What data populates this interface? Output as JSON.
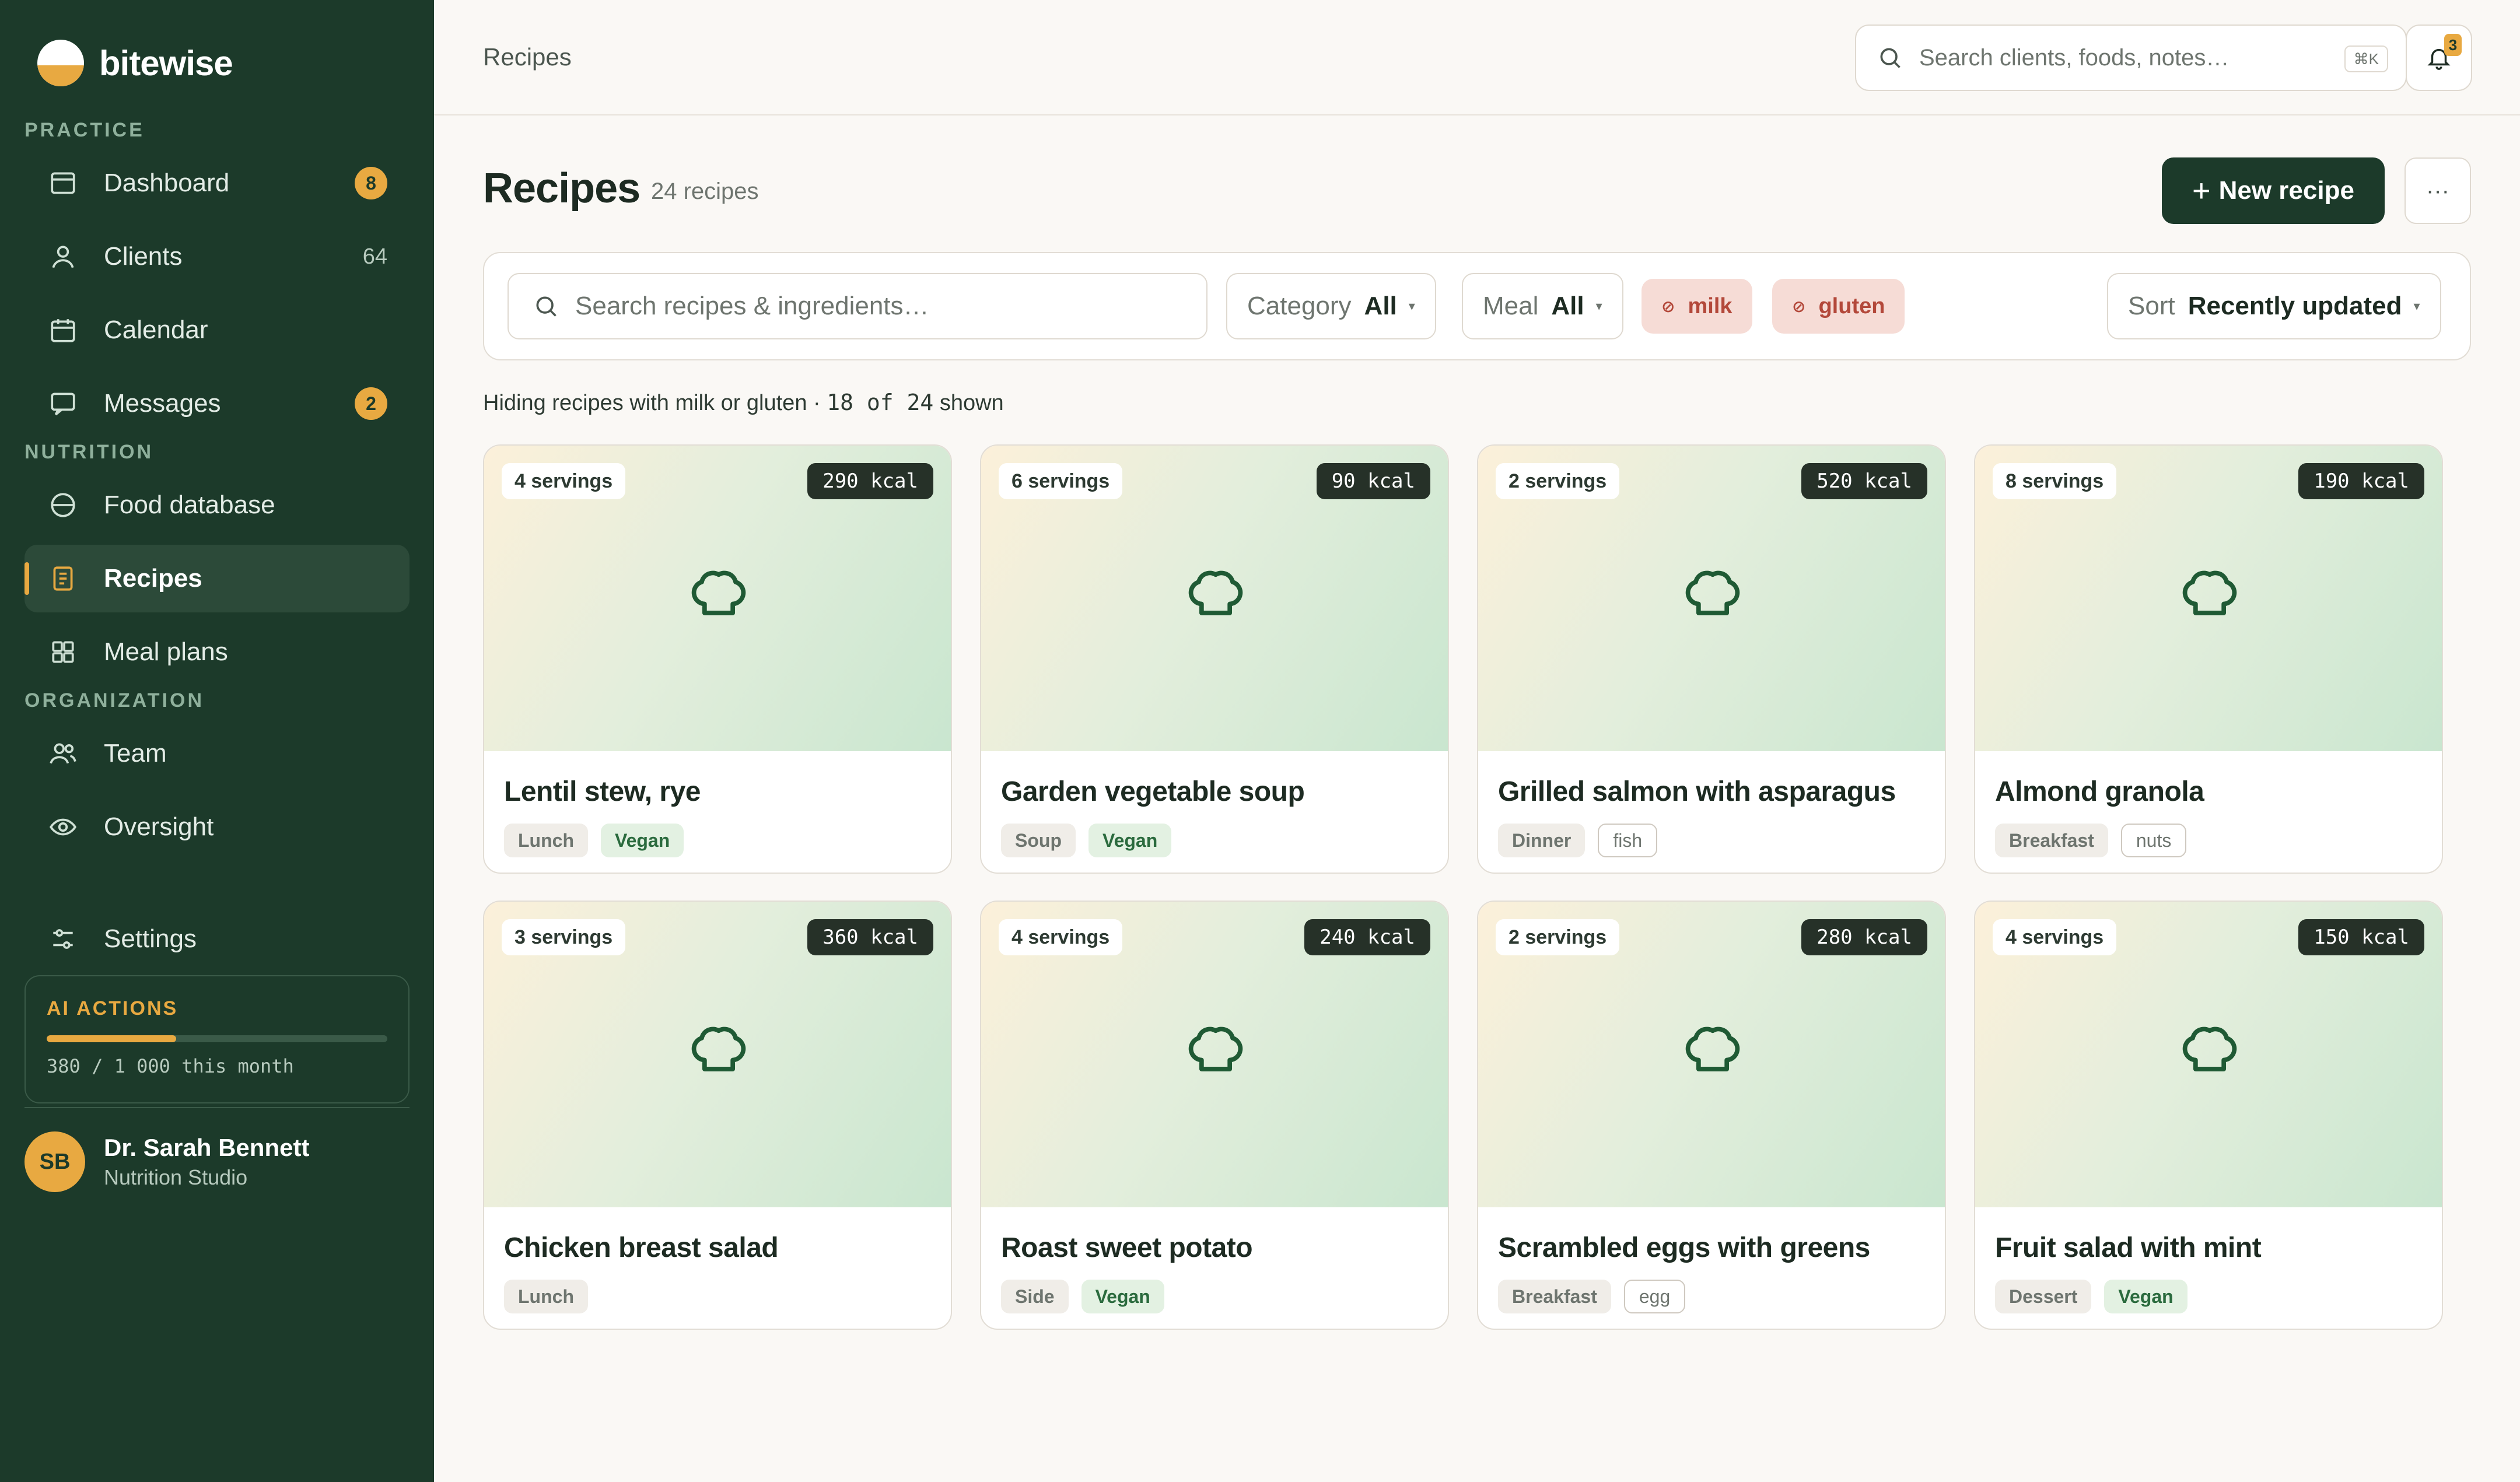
{
  "app": {
    "name": "bitewise"
  },
  "sidebar": {
    "sections": {
      "practice": "PRACTICE",
      "nutrition": "NUTRITION",
      "organization": "ORGANIZATION"
    },
    "items": [
      {
        "label": "Dashboard",
        "icon": "dashboard-icon",
        "badge": "8"
      },
      {
        "label": "Clients",
        "icon": "user-icon",
        "count": "64"
      },
      {
        "label": "Calendar",
        "icon": "calendar-icon"
      },
      {
        "label": "Messages",
        "icon": "message-icon",
        "badge": "2"
      },
      {
        "label": "Food database",
        "icon": "food-icon"
      },
      {
        "label": "Recipes",
        "icon": "recipe-icon",
        "active": true
      },
      {
        "label": "Meal plans",
        "icon": "grid-icon"
      },
      {
        "label": "Team",
        "icon": "team-icon"
      },
      {
        "label": "Oversight",
        "icon": "eye-icon"
      },
      {
        "label": "Settings",
        "icon": "sliders-icon"
      }
    ],
    "ai": {
      "title": "AI ACTIONS",
      "used": 380,
      "limit": 1000,
      "usage_text": "380 / 1 000 this month"
    },
    "user": {
      "initials": "SB",
      "name": "Dr. Sarah Bennett",
      "org": "Nutrition Studio"
    }
  },
  "topbar": {
    "breadcrumb": "Recipes",
    "search_placeholder": "Search clients, foods, notes…",
    "shortcut": "⌘K",
    "notifications": "3"
  },
  "header": {
    "title": "Recipes",
    "count": "24 recipes",
    "new_button": "New recipe",
    "more_label": "···"
  },
  "filters": {
    "search_placeholder": "Search recipes & ingredients…",
    "category_label": "Category",
    "category_value": "All",
    "meal_label": "Meal",
    "meal_value": "All",
    "excluded": [
      "milk",
      "gluten"
    ],
    "sort_label": "Sort",
    "sort_value": "Recently updated"
  },
  "result_note": {
    "text": "Hiding recipes with milk or gluten · ",
    "count": "18 of 24",
    "suffix": " shown"
  },
  "recipes": [
    {
      "title": "Lentil stew, rye",
      "servings": "4 servings",
      "kcal": "290 kcal",
      "tags": [
        {
          "label": "Lunch",
          "kind": "cat"
        },
        {
          "label": "Vegan",
          "kind": "vegan"
        }
      ]
    },
    {
      "title": "Garden vegetable soup",
      "servings": "6 servings",
      "kcal": "90 kcal",
      "tags": [
        {
          "label": "Soup",
          "kind": "cat"
        },
        {
          "label": "Vegan",
          "kind": "vegan"
        }
      ]
    },
    {
      "title": "Grilled salmon with asparagus",
      "servings": "2 servings",
      "kcal": "520 kcal",
      "tags": [
        {
          "label": "Dinner",
          "kind": "cat"
        },
        {
          "label": "fish",
          "kind": "allergen"
        }
      ]
    },
    {
      "title": "Almond granola",
      "servings": "8 servings",
      "kcal": "190 kcal",
      "tags": [
        {
          "label": "Breakfast",
          "kind": "cat"
        },
        {
          "label": "nuts",
          "kind": "allergen"
        }
      ]
    },
    {
      "title": "Chicken breast salad",
      "servings": "3 servings",
      "kcal": "360 kcal",
      "tags": [
        {
          "label": "Lunch",
          "kind": "cat"
        }
      ]
    },
    {
      "title": "Roast sweet potato",
      "servings": "4 servings",
      "kcal": "240 kcal",
      "tags": [
        {
          "label": "Side",
          "kind": "cat"
        },
        {
          "label": "Vegan",
          "kind": "vegan"
        }
      ]
    },
    {
      "title": "Scrambled eggs with greens",
      "servings": "2 servings",
      "kcal": "280 kcal",
      "tags": [
        {
          "label": "Breakfast",
          "kind": "cat"
        },
        {
          "label": "egg",
          "kind": "allergen"
        }
      ]
    },
    {
      "title": "Fruit salad with mint",
      "servings": "4 servings",
      "kcal": "150 kcal",
      "tags": [
        {
          "label": "Dessert",
          "kind": "cat"
        },
        {
          "label": "Vegan",
          "kind": "vegan"
        }
      ]
    }
  ],
  "colors": {
    "sidebar": "#1c3a2a",
    "accent": "#e8a941",
    "primary_button": "#1c3a2a",
    "excluded_chip": "#f6dcd6"
  }
}
